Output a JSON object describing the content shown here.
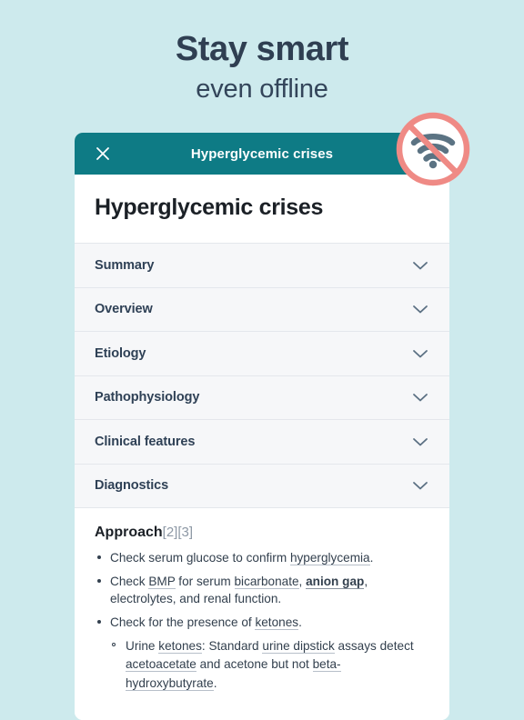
{
  "hero": {
    "headline": "Stay smart",
    "subhead": "even offline"
  },
  "badge": {
    "icon": "wifi-off-icon",
    "ring_color": "#ef8a85",
    "arc_color": "#5b7383",
    "circle_color": "#ffffff"
  },
  "card": {
    "topbar": {
      "title": "Hyperglycemic crises",
      "close_icon": "close-icon",
      "background_color": "#0e7b85",
      "text_color": "#ffffff"
    },
    "article_title": "Hyperglycemic crises",
    "sections": [
      {
        "label": "Summary",
        "chevron": "chevron-down-icon",
        "expanded": false
      },
      {
        "label": "Overview",
        "chevron": "chevron-down-icon",
        "expanded": false
      },
      {
        "label": "Etiology",
        "chevron": "chevron-down-icon",
        "expanded": false
      },
      {
        "label": "Pathophysiology",
        "chevron": "chevron-down-icon",
        "expanded": false
      },
      {
        "label": "Clinical features",
        "chevron": "chevron-down-icon",
        "expanded": false
      },
      {
        "label": "Diagnostics",
        "chevron": "chevron-down-icon",
        "expanded": false
      }
    ],
    "content": {
      "heading": "Approach",
      "heading_refs": "[2][3]",
      "bullets": [
        {
          "segments": [
            {
              "text": "Check serum glucose to confirm ",
              "style": "plain"
            },
            {
              "text": "hyperglycemia",
              "style": "term"
            },
            {
              "text": ".",
              "style": "plain"
            }
          ]
        },
        {
          "segments": [
            {
              "text": "Check ",
              "style": "plain"
            },
            {
              "text": "BMP",
              "style": "term"
            },
            {
              "text": " for serum ",
              "style": "plain"
            },
            {
              "text": "bicarbonate",
              "style": "term"
            },
            {
              "text": ", ",
              "style": "plain"
            },
            {
              "text": "anion gap",
              "style": "term-bold"
            },
            {
              "text": ", electrolytes, and renal function.",
              "style": "plain"
            }
          ]
        },
        {
          "segments": [
            {
              "text": "Check for the presence of ",
              "style": "plain"
            },
            {
              "text": "ketones",
              "style": "term"
            },
            {
              "text": ".",
              "style": "plain"
            }
          ],
          "sub": [
            {
              "segments": [
                {
                  "text": "Urine ",
                  "style": "plain"
                },
                {
                  "text": "ketones",
                  "style": "term"
                },
                {
                  "text": ": Standard ",
                  "style": "plain"
                },
                {
                  "text": "urine dipstick",
                  "style": "term"
                },
                {
                  "text": " assays detect ",
                  "style": "plain"
                },
                {
                  "text": "acetoacetate",
                  "style": "term"
                },
                {
                  "text": " and acetone but not ",
                  "style": "plain"
                },
                {
                  "text": "beta-hydroxybutyrate",
                  "style": "term"
                },
                {
                  "text": ".",
                  "style": "plain"
                }
              ]
            }
          ]
        }
      ]
    }
  },
  "theme": {
    "page_background": "#cdeaed",
    "accordion_background": "#f6f7f9",
    "divider_color": "#e4e7ec",
    "heading_text_color": "#2f3f52",
    "body_text_color": "#33404e"
  }
}
